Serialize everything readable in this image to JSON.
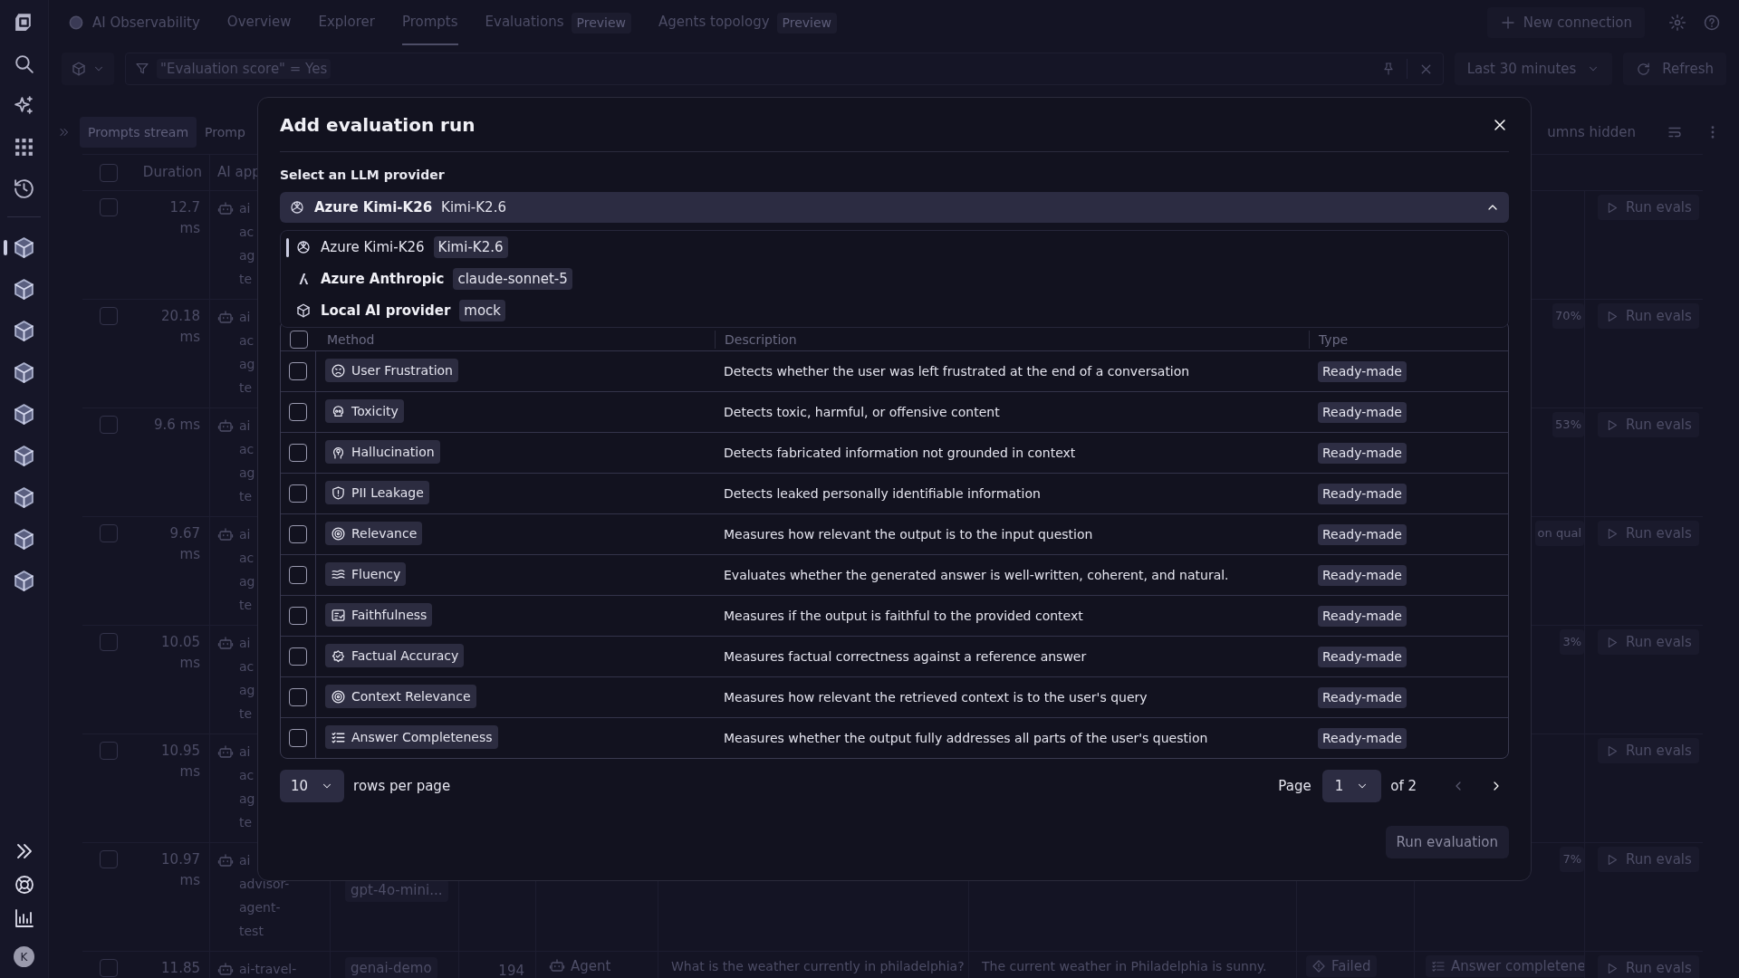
{
  "rail": {
    "items": [
      {
        "kind": "logo",
        "selected": false
      },
      {
        "kind": "search",
        "selected": false
      },
      {
        "kind": "sparkle",
        "selected": false
      },
      {
        "kind": "grid",
        "selected": false
      },
      {
        "kind": "history",
        "selected": false
      },
      {
        "kind": "app",
        "selected": true
      },
      {
        "kind": "app",
        "selected": false
      },
      {
        "kind": "app",
        "selected": false
      },
      {
        "kind": "app",
        "selected": false
      },
      {
        "kind": "app",
        "selected": false
      },
      {
        "kind": "app",
        "selected": false
      },
      {
        "kind": "app",
        "selected": false
      },
      {
        "kind": "app",
        "selected": false
      },
      {
        "kind": "app",
        "selected": false
      }
    ],
    "bottom": [
      {
        "kind": "expand"
      },
      {
        "kind": "help"
      },
      {
        "kind": "chart"
      }
    ],
    "avatar": "K"
  },
  "nav": {
    "app_title": "AI Observability",
    "tabs": [
      {
        "label": "Overview",
        "selected": false
      },
      {
        "label": "Explorer",
        "selected": false
      },
      {
        "label": "Prompts",
        "selected": true
      },
      {
        "label": "Evaluations",
        "badge": "Preview",
        "selected": false
      },
      {
        "label": "Agents topology",
        "badge": "Preview",
        "selected": false
      }
    ],
    "new_connection": "New connection"
  },
  "filter_bar": {
    "filter": "\"Evaluation score\" = Yes",
    "timeframe": "Last 30 minutes",
    "refresh": "Refresh"
  },
  "view_tabs": [
    {
      "label": "Prompts stream",
      "selected": true
    },
    {
      "label": "Promp",
      "selected": false
    }
  ],
  "columns_hidden": "umns hidden",
  "table": {
    "columns": [
      "Duration",
      "AI app"
    ],
    "all_checked": false,
    "rows": [
      {
        "checked": false,
        "duration": "12.7 ms",
        "ai_app": [
          "ai",
          "ac",
          "ag",
          "te"
        ],
        "column_10": "Run evals"
      },
      {
        "checked": false,
        "duration": "20.18 ms",
        "ai_app": [
          "ai",
          "ac",
          "ag",
          "te"
        ],
        "column_9": "70%",
        "column_10": "Run evals"
      },
      {
        "checked": false,
        "duration": "9.6 ms",
        "ai_app": [
          "ai",
          "ac",
          "ag",
          "te"
        ],
        "column_9": "53%",
        "column_10": "Run evals"
      },
      {
        "checked": false,
        "duration": "9.67 ms",
        "ai_app": [
          "ai",
          "ac",
          "ag",
          "te"
        ],
        "column_9": "on qual",
        "column_10": "Run evals"
      },
      {
        "checked": false,
        "duration": "10.05 ms",
        "ai_app": [
          "ai",
          "ac",
          "ag",
          "te"
        ],
        "column_9": "3%",
        "column_10": "Run evals"
      },
      {
        "checked": false,
        "duration": "10.95 ms",
        "ai_app": [
          "ai",
          "ac",
          "ag",
          "te"
        ],
        "column_10": "Run evals"
      },
      {
        "checked": false,
        "duration": "10.97 ms",
        "ai_app": [
          "ai",
          "advisor-",
          "agent-",
          "test"
        ],
        "column_3": "gpt-4o-mini...",
        "column_9": "7%",
        "column_10": "Run evals"
      },
      {
        "checked": false,
        "duration": "11.85",
        "ai_app": [
          "ai-travel-"
        ],
        "column_3": "genai-demo",
        "column_4": "194",
        "column_5": "Agent",
        "column_6": "What is the weather currently in philadelphia?",
        "column_7": "The current weather in Philadelphia is sunny.",
        "column_8": "Failed",
        "column_9": "Answer completene",
        "column_10": "Run evals"
      }
    ]
  },
  "dialog": {
    "title": "Add evaluation run",
    "provider_label": "Select an LLM provider",
    "provider": {
      "kind": "openai",
      "name": "Azure Kimi-K26",
      "model": "Kimi-K2.6",
      "expanded": true
    },
    "provider_options": [
      {
        "kind": "openai",
        "name": "Azure Kimi-K26",
        "model": "Kimi-K2.6",
        "selected": true
      },
      {
        "kind": "anthropic",
        "name": "Azure Anthropic",
        "model": "claude-sonnet-5",
        "selected": false
      },
      {
        "kind": "local",
        "name": "Local AI provider",
        "model": "mock",
        "selected": false
      }
    ],
    "columns": [
      "Method",
      "Description",
      "Type"
    ],
    "all_checked": false,
    "methods": [
      {
        "kind": "frustration",
        "name": "User Frustration",
        "description": "Detects whether the user was left frustrated at the end of a conversation",
        "type": "Ready-made",
        "checked": false
      },
      {
        "kind": "toxicity",
        "name": "Toxicity",
        "description": "Detects toxic, harmful, or offensive content",
        "type": "Ready-made",
        "checked": false
      },
      {
        "kind": "hallucination",
        "name": "Hallucination",
        "description": "Detects fabricated information not grounded in context",
        "type": "Ready-made",
        "checked": false
      },
      {
        "kind": "pii",
        "name": "PII Leakage",
        "description": "Detects leaked personally identifiable information",
        "type": "Ready-made",
        "checked": false
      },
      {
        "kind": "target",
        "name": "Relevance",
        "description": "Measures how relevant the output is to the input question",
        "type": "Ready-made",
        "checked": false
      },
      {
        "kind": "fluency",
        "name": "Fluency",
        "description": "Evaluates whether the generated answer is well-written, coherent, and natural.",
        "type": "Ready-made",
        "checked": false
      },
      {
        "kind": "faithfulness",
        "name": "Faithfulness",
        "description": "Measures if the output is faithful to the provided context",
        "type": "Ready-made",
        "checked": false
      },
      {
        "kind": "factual",
        "name": "Factual Accuracy",
        "description": "Measures factual correctness against a reference answer",
        "type": "Ready-made",
        "checked": false
      },
      {
        "kind": "target",
        "name": "Context Relevance",
        "description": "Measures how relevant the retrieved context is to the user's query",
        "type": "Ready-made",
        "checked": false
      },
      {
        "kind": "completeness",
        "name": "Answer Completeness",
        "description": "Measures whether the output fully addresses all parts of the user's question",
        "type": "Ready-made",
        "checked": false
      }
    ],
    "rows_per_page": "10",
    "rows_per_page_label": "rows per page",
    "page_label": "Page",
    "page": "1",
    "page_total": "of 2",
    "run_button": {
      "label": "Run evaluation",
      "disabled": true
    }
  }
}
